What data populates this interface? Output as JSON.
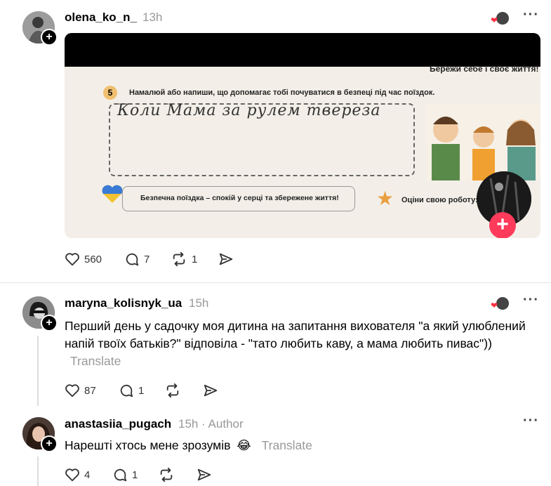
{
  "post1": {
    "username": "olena_ko_n_",
    "time": "13h",
    "likes": "560",
    "comments": "7",
    "reposts": "1",
    "image": {
      "task_number": "5",
      "task_text": "Намалюй або напиши, що допомагає тобі почуватися в безпеці під час поїздок.",
      "handwriting": "Коли Мама за рулем тверезa",
      "banner_top_right": "Бережи себе і своє життя!",
      "slogan": "Безпечна поїздка – спокій у серці та збережене життя!",
      "rate_label": "Оціни свою роботу:"
    }
  },
  "reply1": {
    "username": "maryna_kolisnyk_ua",
    "time": "15h",
    "text": "Перший день у садочку моя дитина на запитання вихователя \"а який улюблений напій твоїх батьків?\" відповіла - \"тато любить каву, а мама любить пивас\"))",
    "translate": "Translate",
    "likes": "87",
    "comments": "1"
  },
  "reply2": {
    "username": "anastasiia_pugach",
    "time": "15h",
    "author_tag": "· Author",
    "text": "Нарешті хтось мене зрозумів",
    "emoji": "😂",
    "translate": "Translate",
    "likes": "4",
    "comments": "1"
  },
  "colors": {
    "accent_red": "#ff3040",
    "secondary_text": "#999999"
  }
}
